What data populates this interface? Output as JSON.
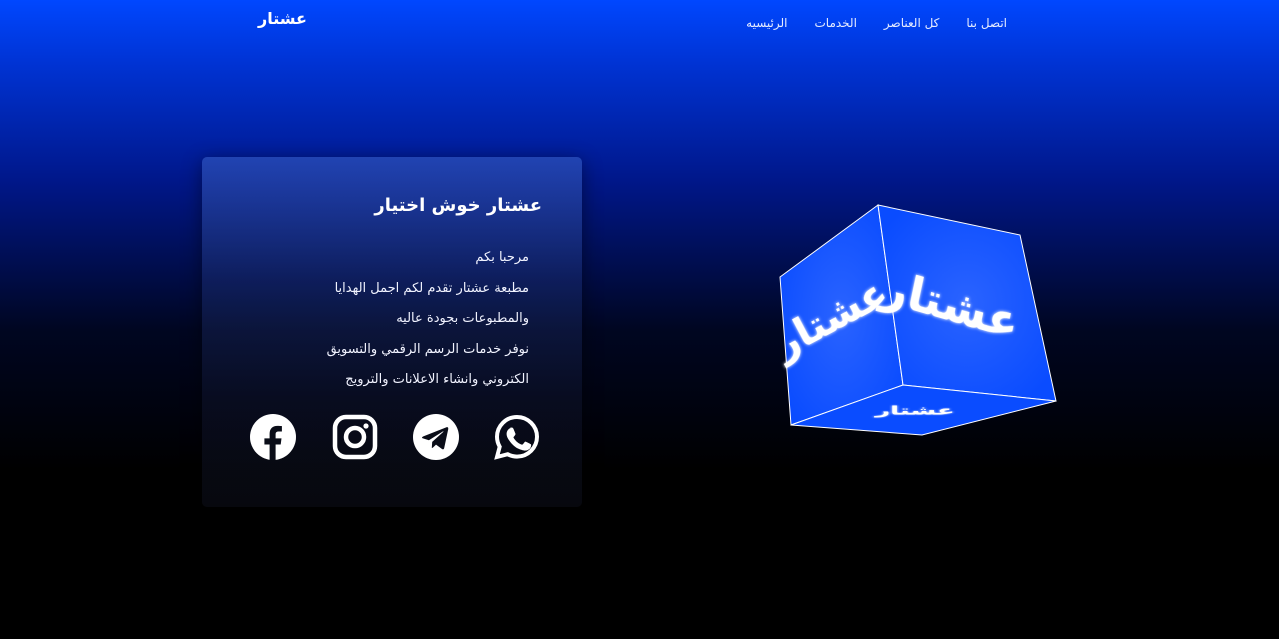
{
  "navbar": {
    "brand": "عشتار",
    "links": [
      {
        "label": "اتصل بنا"
      },
      {
        "label": "كل العناصر"
      },
      {
        "label": "الخدمات"
      },
      {
        "label": "الرئيسيه"
      }
    ]
  },
  "card": {
    "title": "عشتار خوش اختيار",
    "lines": [
      "مرحبا بكم",
      "مطبعة عشتار تقدم لكم اجمل الهدايا",
      "والمطبوعات بجودة عاليه",
      "نوفر خدمات الرسم الرقمي والتسويق",
      "الكتروني وانشاء الاعلانات والترويج"
    ]
  },
  "socials": [
    {
      "icon": "facebook-icon"
    },
    {
      "icon": "instagram-icon"
    },
    {
      "icon": "telegram-icon"
    },
    {
      "icon": "whatsapp-icon"
    }
  ],
  "cube": {
    "face_text": "عشتار",
    "face_color": "#0a4cff"
  },
  "colors": {
    "accent": "#0047ff",
    "background_bottom": "#000000"
  }
}
